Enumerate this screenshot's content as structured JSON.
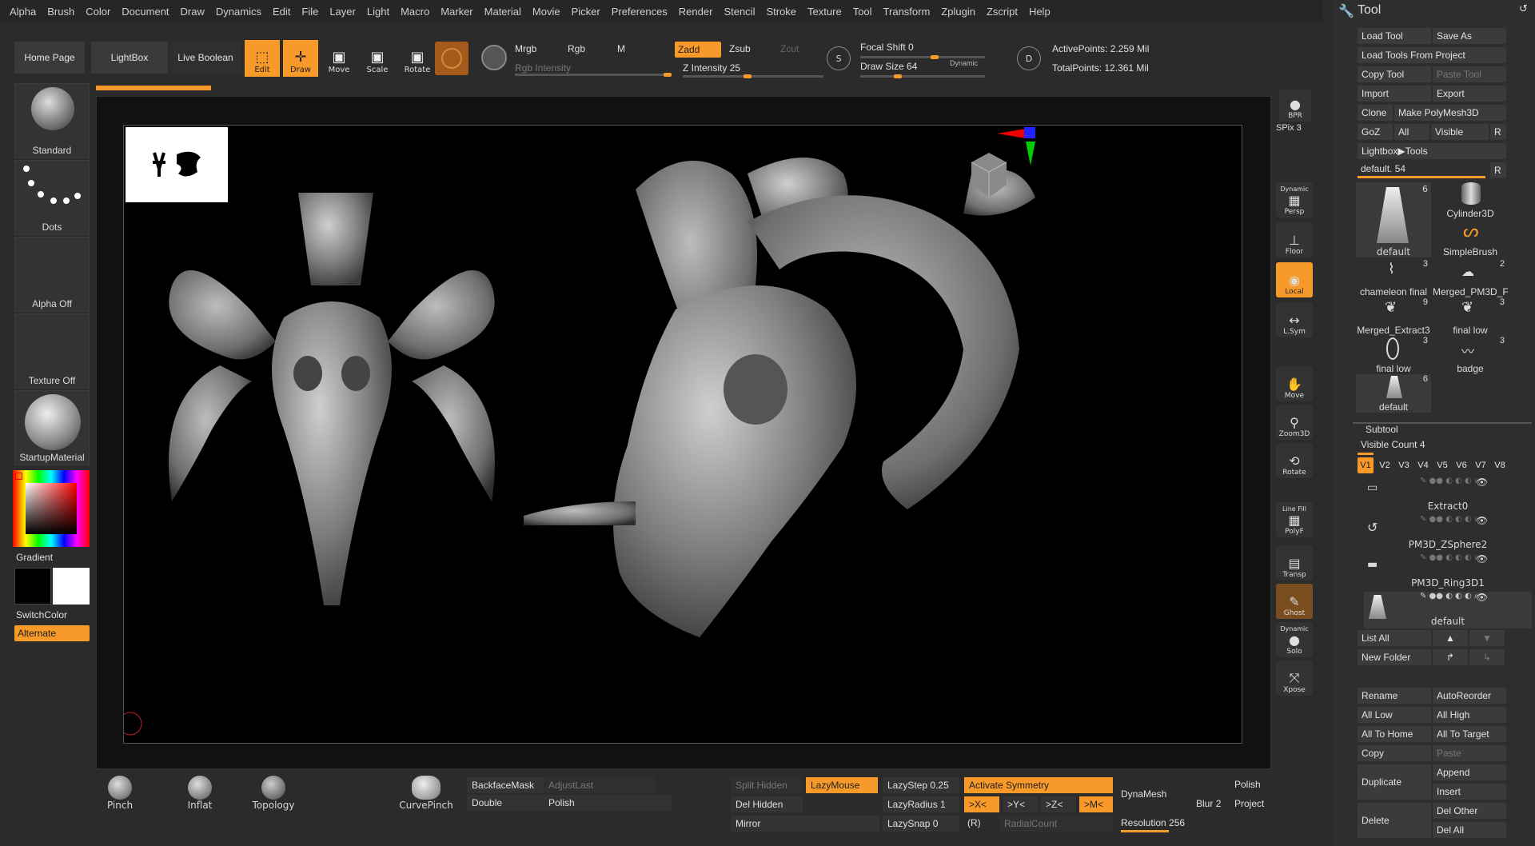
{
  "menu": [
    "Alpha",
    "Brush",
    "Color",
    "Document",
    "Draw",
    "Dynamics",
    "Edit",
    "File",
    "Layer",
    "Light",
    "Macro",
    "Marker",
    "Material",
    "Movie",
    "Picker",
    "Preferences",
    "Render",
    "Stencil",
    "Stroke",
    "Texture",
    "Tool",
    "Transform",
    "Zplugin",
    "Zscript",
    "Help"
  ],
  "topbar": {
    "home_page": "Home Page",
    "lightbox": "LightBox",
    "live_boolean": "Live Boolean",
    "edit": "Edit",
    "draw": "Draw",
    "move": "Move",
    "scale": "Scale",
    "rotate": "Rotate",
    "mrgb": "Mrgb",
    "rgb": "Rgb",
    "m": "M",
    "rgb_intensity": "Rgb Intensity",
    "zadd": "Zadd",
    "zsub": "Zsub",
    "zcut": "Zcut",
    "z_intensity_label": "Z Intensity",
    "z_intensity_value": "25",
    "focal_shift_label": "Focal Shift",
    "focal_shift_value": "0",
    "draw_size_label": "Draw Size",
    "draw_size_value": "64",
    "dynamic": "Dynamic",
    "active_points": "ActivePoints: 2.259 Mil",
    "total_points": "TotalPoints: 12.361 Mil",
    "s_label": "S",
    "d_label": "D"
  },
  "leftshelf": {
    "brush": "Standard",
    "stroke": "Dots",
    "alpha": "Alpha Off",
    "texture": "Texture Off",
    "material": "StartupMaterial",
    "gradient": "Gradient",
    "switchcolor": "SwitchColor",
    "alternate": "Alternate"
  },
  "rightshelf": {
    "bpr": "BPR",
    "spix": "SPix 3",
    "persp_top": "Dynamic",
    "persp": "Persp",
    "floor": "Floor",
    "local": "Local",
    "lsym": "L.Sym",
    "move": "Move",
    "zoom3d": "Zoom3D",
    "rotate": "Rotate",
    "linefill": "Line Fill",
    "polyf": "PolyF",
    "transp": "Transp",
    "ghost": "Ghost",
    "solo_top": "Dynamic",
    "solo": "Solo",
    "xpose": "Xpose"
  },
  "tool": {
    "title": "Tool",
    "load_tool": "Load Tool",
    "save_as": "Save As",
    "load_from_project": "Load Tools From Project",
    "copy_tool": "Copy Tool",
    "paste_tool": "Paste Tool",
    "import": "Import",
    "export": "Export",
    "clone": "Clone",
    "make_polymesh": "Make PolyMesh3D",
    "goz": "GoZ",
    "all": "All",
    "visible": "Visible",
    "r": "R",
    "lightbox_tools": "Lightbox▶Tools",
    "default_label": "default.",
    "default_value": "54",
    "thumbs": [
      {
        "name": "default",
        "count": "6"
      },
      {
        "name": "Cylinder3D",
        "count": ""
      },
      {
        "name": "",
        "count": ""
      },
      {
        "name": "SimpleBrush",
        "count": ""
      },
      {
        "name": "chameleon final",
        "count": "3"
      },
      {
        "name": "Merged_PM3D_F",
        "count": "2"
      },
      {
        "name": "Merged_Extract3",
        "count": "9"
      },
      {
        "name": "final low",
        "count": "3"
      },
      {
        "name": "final low",
        "count": "3"
      },
      {
        "name": "badge",
        "count": "3"
      },
      {
        "name": "default",
        "count": "6"
      }
    ]
  },
  "subtool": {
    "title": "Subtool",
    "visible_count": "Visible Count 4",
    "tabs": [
      "V1",
      "V2",
      "V3",
      "V4",
      "V5",
      "V6",
      "V7",
      "V8"
    ],
    "items": [
      "Extract0",
      "PM3D_ZSphere2",
      "PM3D_Ring3D1",
      "default"
    ],
    "list_all": "List All",
    "new_folder": "New Folder",
    "rename": "Rename",
    "autoreorder": "AutoReorder",
    "all_low": "All Low",
    "all_high": "All High",
    "all_to_home": "All To Home",
    "all_to_target": "All To Target",
    "copy": "Copy",
    "paste": "Paste",
    "duplicate": "Duplicate",
    "append": "Append",
    "insert": "Insert",
    "delete": "Delete",
    "del_other": "Del Other",
    "del_all": "Del All"
  },
  "bottombar": {
    "pinch": "Pinch",
    "inflat": "Inflat",
    "topology": "Topology",
    "curvepinch": "CurvePinch",
    "backfacemask": "BackfaceMask",
    "adjustlast": "AdjustLast",
    "double": "Double",
    "polish": "Polish",
    "split_hidden": "Split Hidden",
    "lazymouse": "LazyMouse",
    "lazystep_label": "LazyStep",
    "lazystep_value": "0.25",
    "activate_symmetry": "Activate Symmetry",
    "dynamesh": "DynaMesh",
    "polish2": "Polish",
    "del_hidden": "Del Hidden",
    "lazyradius_label": "LazyRadius",
    "lazyradius_value": "1",
    "x": ">X<",
    "y": ">Y<",
    "z": ">Z<",
    "m": ">M<",
    "blur_label": "Blur",
    "blur_value": "2",
    "project": "Project",
    "mirror": "Mirror",
    "lazysnap_label": "LazySnap",
    "lazysnap_value": "0",
    "r": "(R)",
    "radialcount": "RadialCount",
    "resolution_label": "Resolution",
    "resolution_value": "256"
  },
  "colors": {
    "accent": "#f79a2a",
    "panel": "#2e2e2e",
    "canvas": "#000000"
  }
}
